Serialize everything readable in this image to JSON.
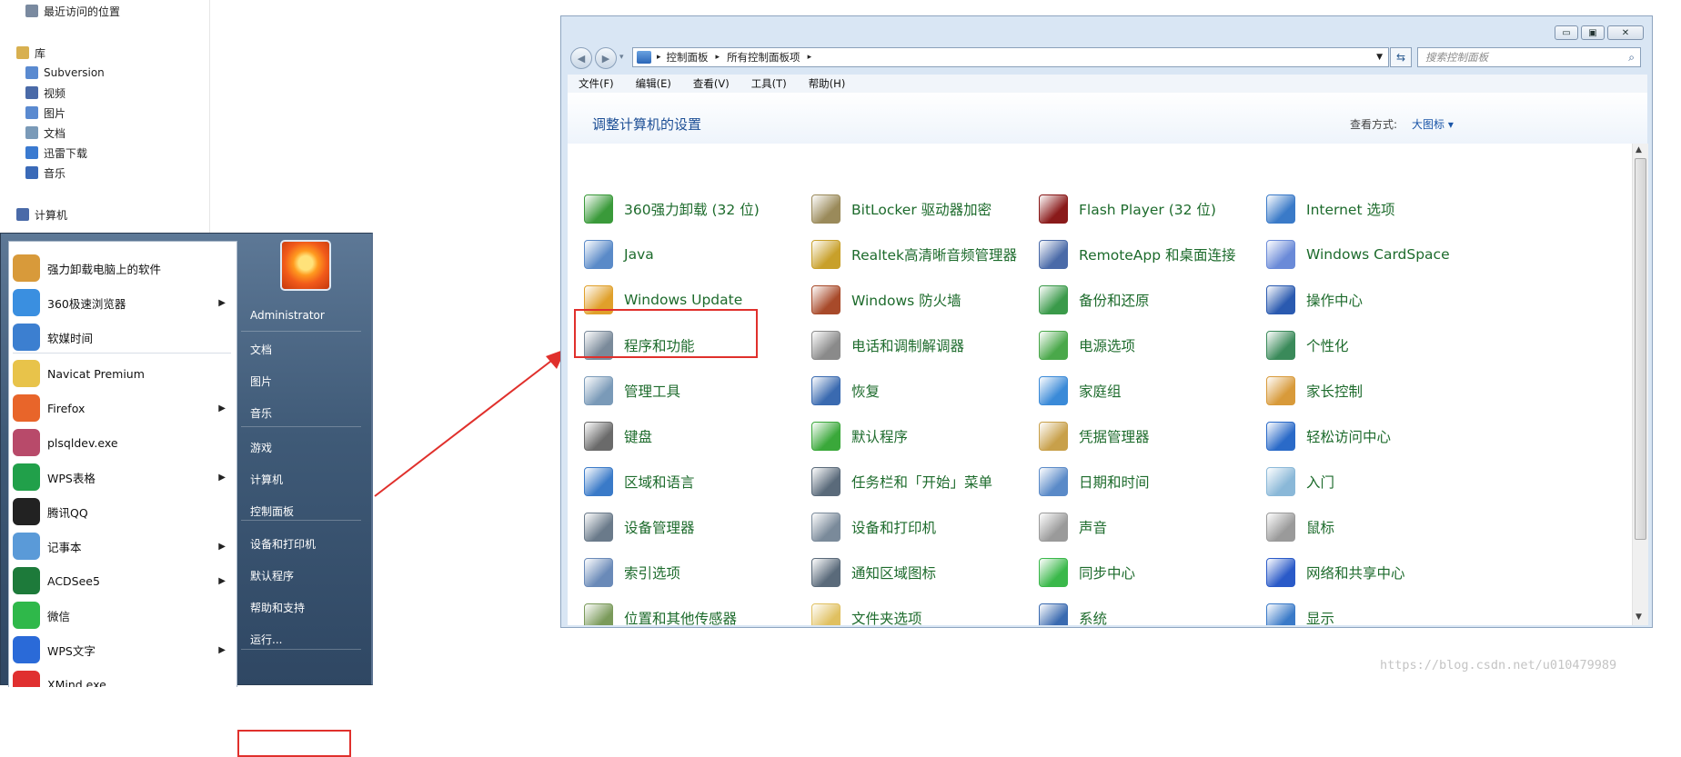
{
  "explorer_nav": {
    "items": [
      {
        "label": "最近访问的位置",
        "icon": "recent-places-icon"
      },
      {
        "label": "库",
        "icon": "library-icon"
      },
      {
        "label": "Subversion",
        "icon": "folder-icon"
      },
      {
        "label": "视频",
        "icon": "video-icon"
      },
      {
        "label": "图片",
        "icon": "picture-icon"
      },
      {
        "label": "文档",
        "icon": "document-icon"
      },
      {
        "label": "迅雷下载",
        "icon": "download-icon"
      },
      {
        "label": "音乐",
        "icon": "music-icon"
      },
      {
        "label": "计算机",
        "icon": "computer-icon"
      }
    ]
  },
  "start_menu": {
    "programs": [
      {
        "label": "强力卸载电脑上的软件",
        "has_submenu": false,
        "color": "#d89a3a"
      },
      {
        "label": "360极速浏览器",
        "has_submenu": true,
        "color": "#3a8fe0"
      },
      {
        "label": "软媒时间",
        "has_submenu": false,
        "color": "#3c7fd0"
      },
      {
        "label": "Navicat Premium",
        "has_submenu": false,
        "color": "#e8c34a"
      },
      {
        "label": "Firefox",
        "has_submenu": true,
        "color": "#e8652a"
      },
      {
        "label": "plsqldev.exe",
        "has_submenu": false,
        "color": "#b84a6a"
      },
      {
        "label": "WPS表格",
        "has_submenu": true,
        "color": "#21a04a"
      },
      {
        "label": "腾讯QQ",
        "has_submenu": false,
        "color": "#222222"
      },
      {
        "label": "记事本",
        "has_submenu": true,
        "color": "#5a9ad8"
      },
      {
        "label": "ACDSee5",
        "has_submenu": true,
        "color": "#1d7a3a"
      },
      {
        "label": "微信",
        "has_submenu": false,
        "color": "#2fb84a"
      },
      {
        "label": "WPS文字",
        "has_submenu": true,
        "color": "#2a6ad8"
      },
      {
        "label": "XMind.exe",
        "has_submenu": false,
        "color": "#e03030"
      }
    ],
    "right_items": [
      "Administrator",
      "文档",
      "图片",
      "音乐",
      "游戏",
      "计算机",
      "控制面板",
      "设备和打印机",
      "默认程序",
      "帮助和支持",
      "运行..."
    ]
  },
  "window": {
    "controls": {
      "minimize": "▭",
      "maximize": "▣",
      "close": "✕"
    },
    "breadcrumb": [
      "控制面板",
      "所有控制面板项"
    ],
    "search_placeholder": "搜索控制面板",
    "menu": [
      "文件(F)",
      "编辑(E)",
      "查看(V)",
      "工具(T)",
      "帮助(H)"
    ],
    "title": "调整计算机的设置",
    "view_label": "查看方式:",
    "view_value": "大图标 ▾",
    "items": [
      {
        "label": "360强力卸载 (32 位)",
        "icon": "uninstaller-icon",
        "color": "#3a9a3a"
      },
      {
        "label": "BitLocker 驱动器加密",
        "icon": "bitlocker-key-icon",
        "color": "#9a8a5a"
      },
      {
        "label": "Flash Player (32 位)",
        "icon": "flash-icon",
        "color": "#8a1a1a"
      },
      {
        "label": "Internet 选项",
        "icon": "internet-globe-icon",
        "color": "#3a7ac8"
      },
      {
        "label": "Java",
        "icon": "java-icon",
        "color": "#5a8ac8"
      },
      {
        "label": "Realtek高清晰音频管理器",
        "icon": "audio-manager-icon",
        "color": "#c8a02a"
      },
      {
        "label": "RemoteApp 和桌面连接",
        "icon": "remote-desktop-icon",
        "color": "#4a6aa8"
      },
      {
        "label": "Windows CardSpace",
        "icon": "cardspace-icon",
        "color": "#6a8ad8"
      },
      {
        "label": "Windows Update",
        "icon": "windows-update-icon",
        "color": "#e0a02a"
      },
      {
        "label": "Windows 防火墙",
        "icon": "firewall-icon",
        "color": "#a84a2a"
      },
      {
        "label": "备份和还原",
        "icon": "backup-icon",
        "color": "#3a9a4a"
      },
      {
        "label": "操作中心",
        "icon": "action-center-flag-icon",
        "color": "#2a5ab0"
      },
      {
        "label": "程序和功能",
        "icon": "programs-features-icon",
        "color": "#7a8a9a"
      },
      {
        "label": "电话和调制解调器",
        "icon": "phone-modem-icon",
        "color": "#8a8a8a"
      },
      {
        "label": "电源选项",
        "icon": "power-options-icon",
        "color": "#4aa84a"
      },
      {
        "label": "个性化",
        "icon": "personalization-icon",
        "color": "#3a8a5a"
      },
      {
        "label": "管理工具",
        "icon": "admin-tools-icon",
        "color": "#7a9ab8"
      },
      {
        "label": "恢复",
        "icon": "recovery-icon",
        "color": "#3a6ab0"
      },
      {
        "label": "家庭组",
        "icon": "homegroup-icon",
        "color": "#3a8ad8"
      },
      {
        "label": "家长控制",
        "icon": "parental-controls-icon",
        "color": "#d89a3a"
      },
      {
        "label": "键盘",
        "icon": "keyboard-icon",
        "color": "#6a6a6a"
      },
      {
        "label": "默认程序",
        "icon": "default-programs-icon",
        "color": "#3aa83a"
      },
      {
        "label": "凭据管理器",
        "icon": "credential-manager-icon",
        "color": "#c8a04a"
      },
      {
        "label": "轻松访问中心",
        "icon": "ease-of-access-icon",
        "color": "#2a6ac8"
      },
      {
        "label": "区域和语言",
        "icon": "region-language-icon",
        "color": "#3a7ac8"
      },
      {
        "label": "任务栏和「开始」菜单",
        "icon": "taskbar-icon",
        "color": "#5a6a7a"
      },
      {
        "label": "日期和时间",
        "icon": "date-time-icon",
        "color": "#5a8ac8"
      },
      {
        "label": "入门",
        "icon": "getting-started-icon",
        "color": "#8ab8d8"
      },
      {
        "label": "设备管理器",
        "icon": "device-manager-icon",
        "color": "#6a7a8a"
      },
      {
        "label": "设备和打印机",
        "icon": "devices-printers-icon",
        "color": "#7a8a9a"
      },
      {
        "label": "声音",
        "icon": "sound-icon",
        "color": "#9a9a9a"
      },
      {
        "label": "鼠标",
        "icon": "mouse-icon",
        "color": "#9a9a9a"
      },
      {
        "label": "索引选项",
        "icon": "indexing-icon",
        "color": "#6a8ab8"
      },
      {
        "label": "通知区域图标",
        "icon": "notification-area-icon",
        "color": "#5a6a7a"
      },
      {
        "label": "同步中心",
        "icon": "sync-center-icon",
        "color": "#3ab84a"
      },
      {
        "label": "网络和共享中心",
        "icon": "network-sharing-icon",
        "color": "#2a5ac8"
      },
      {
        "label": "位置和其他传感器",
        "icon": "location-sensors-icon",
        "color": "#7a9a5a"
      },
      {
        "label": "文件夹选项",
        "icon": "folder-options-icon",
        "color": "#e0c060"
      },
      {
        "label": "系统",
        "icon": "system-icon",
        "color": "#3a6ab0"
      },
      {
        "label": "显示",
        "icon": "display-icon",
        "color": "#3a7ac8"
      }
    ]
  },
  "watermark": "https://blog.csdn.net/u010479989"
}
